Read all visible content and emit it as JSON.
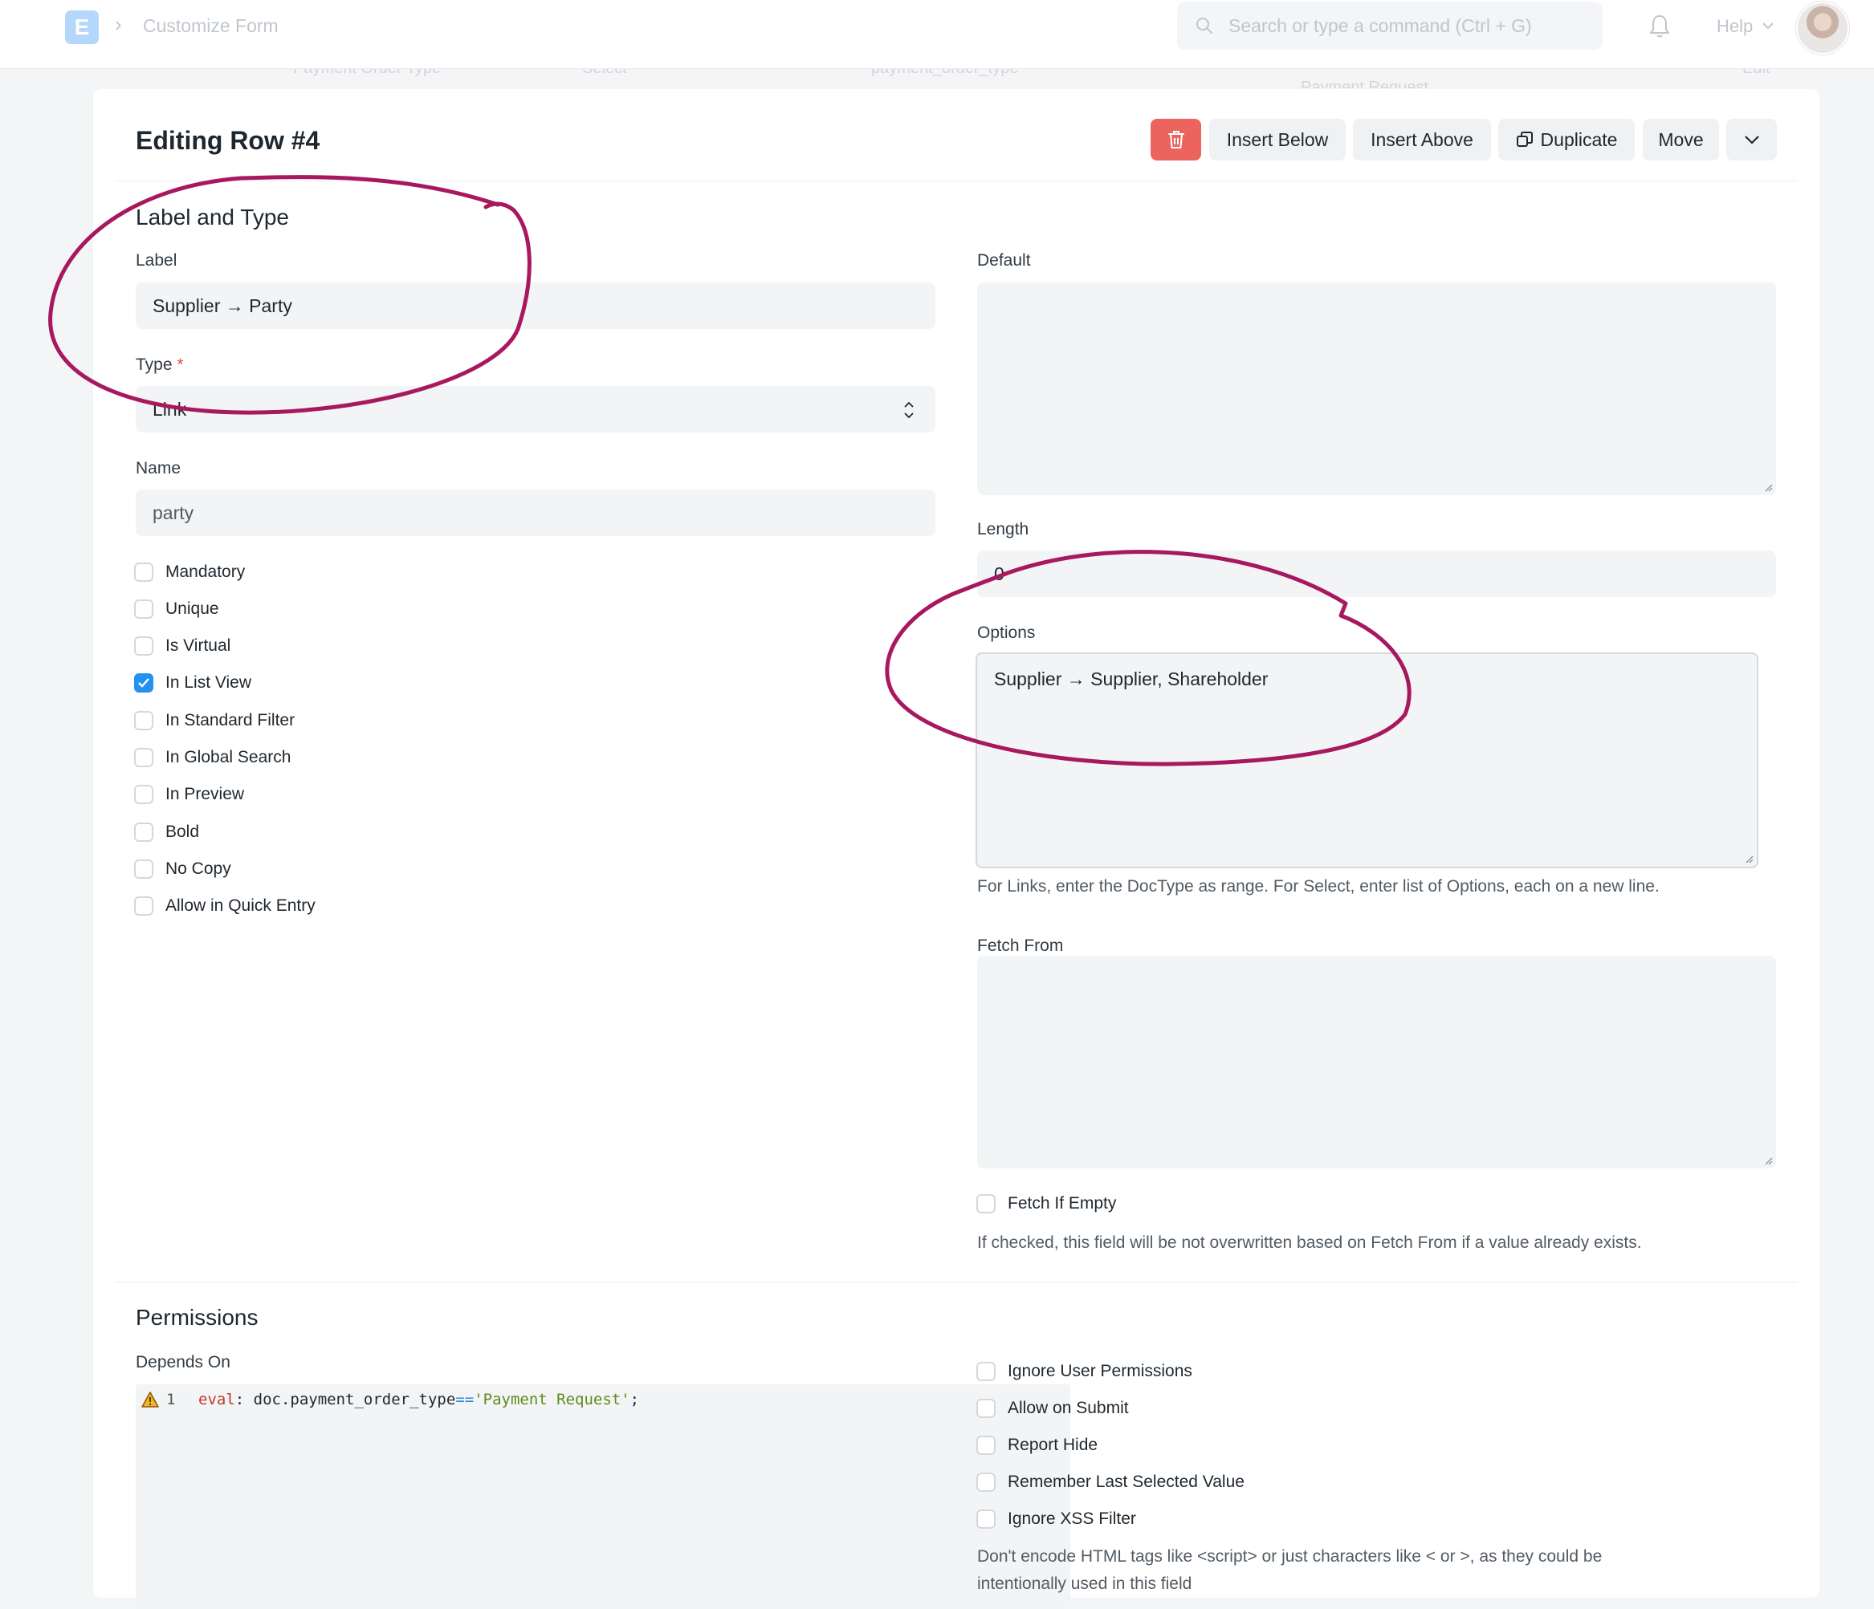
{
  "navbar": {
    "logo_letter": "E",
    "breadcrumb": "Customize Form",
    "search_placeholder": "Search or type a command (Ctrl + G)",
    "help_label": "Help"
  },
  "background_list": {
    "cells": [
      "Payment Order Type",
      "Select",
      "payment_order_type",
      "Payment Request",
      "Edit"
    ]
  },
  "dialog": {
    "title": "Editing Row #4",
    "buttons": {
      "insert_below": "Insert Below",
      "insert_above": "Insert Above",
      "duplicate": "Duplicate",
      "move": "Move"
    }
  },
  "label_type": {
    "section_title": "Label and Type",
    "label_label": "Label",
    "label_value": "Supplier → Party",
    "type_label": "Type",
    "type_required_mark": "*",
    "type_value": "Link",
    "name_label": "Name",
    "name_value": "party",
    "checkboxes": [
      {
        "label": "Mandatory",
        "checked": false
      },
      {
        "label": "Unique",
        "checked": false
      },
      {
        "label": "Is Virtual",
        "checked": false
      },
      {
        "label": "In List View",
        "checked": true
      },
      {
        "label": "In Standard Filter",
        "checked": false
      },
      {
        "label": "In Global Search",
        "checked": false
      },
      {
        "label": "In Preview",
        "checked": false
      },
      {
        "label": "Bold",
        "checked": false
      },
      {
        "label": "No Copy",
        "checked": false
      },
      {
        "label": "Allow in Quick Entry",
        "checked": false
      }
    ]
  },
  "right_col": {
    "default_label": "Default",
    "default_value": "",
    "length_label": "Length",
    "length_value": "0",
    "options_label": "Options",
    "options_value": "Supplier → Supplier, Shareholder",
    "options_help": "For Links, enter the DocType as range. For Select, enter list of Options, each on a new line.",
    "fetch_from_label": "Fetch From",
    "fetch_from_value": "",
    "fetch_if_empty_label": "Fetch If Empty",
    "fetch_if_empty_checked": false,
    "fetch_if_empty_help": "If checked, this field will be not overwritten based on Fetch From if a value already exists."
  },
  "permissions": {
    "section_title": "Permissions",
    "depends_on_label": "Depends On",
    "code_line_number": "1",
    "code_tokens": {
      "kw": "eval",
      "t1": ": doc.payment_order_type",
      "op": "==",
      "str": "'Payment Request'",
      "t2": ";"
    },
    "checkboxes": [
      {
        "label": "Ignore User Permissions",
        "checked": false
      },
      {
        "label": "Allow on Submit",
        "checked": false
      },
      {
        "label": "Report Hide",
        "checked": false
      },
      {
        "label": "Remember Last Selected Value",
        "checked": false
      },
      {
        "label": "Ignore XSS Filter",
        "checked": false
      }
    ],
    "xss_help_line1": "Don't encode HTML tags like <script> or just characters like < or >, as they could be",
    "xss_help_line2": "intentionally used in this field"
  },
  "colors": {
    "annotation": "#a8185f",
    "delete_button": "#ec645e",
    "checkbox_checked": "#2490ef",
    "logo": "#b4d7fb"
  }
}
